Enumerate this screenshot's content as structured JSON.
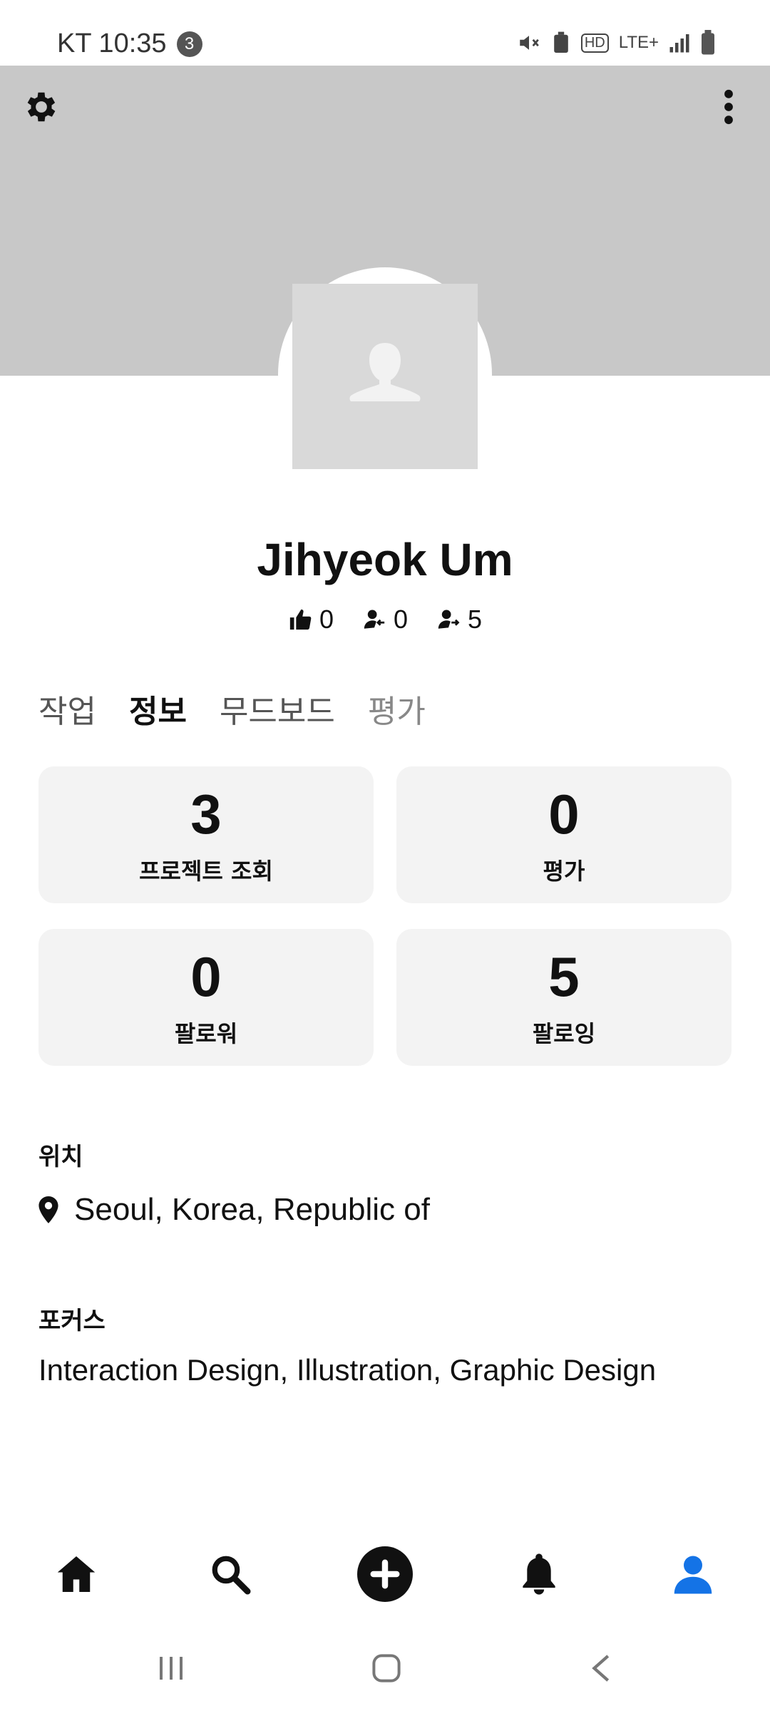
{
  "status_bar": {
    "carrier_time": "KT 10:35",
    "notification_count": "3",
    "network": "LTE+",
    "hd": "HD"
  },
  "profile": {
    "name": "Jihyeok Um",
    "appreciations": "0",
    "followers_icon_count": "0",
    "following_icon_count": "5"
  },
  "tabs": [
    {
      "label": "작업"
    },
    {
      "label": "정보"
    },
    {
      "label": "무드보드"
    },
    {
      "label": "평가"
    }
  ],
  "cards": [
    {
      "value": "3",
      "label": "프로젝트 조회"
    },
    {
      "value": "0",
      "label": "평가"
    },
    {
      "value": "0",
      "label": "팔로워"
    },
    {
      "value": "5",
      "label": "팔로잉"
    }
  ],
  "location": {
    "heading": "위치",
    "value": "Seoul, Korea, Republic of"
  },
  "focus": {
    "heading": "포커스",
    "value": "Interaction Design, Illustration, Graphic Design"
  },
  "bottom_nav": {
    "icons": [
      "home-icon",
      "search-icon",
      "add-icon",
      "bell-icon",
      "profile-icon"
    ],
    "active": "profile-icon"
  },
  "colors": {
    "accent": "#1473e6",
    "cover": "#c8c8c8",
    "card": "#f3f3f3"
  }
}
